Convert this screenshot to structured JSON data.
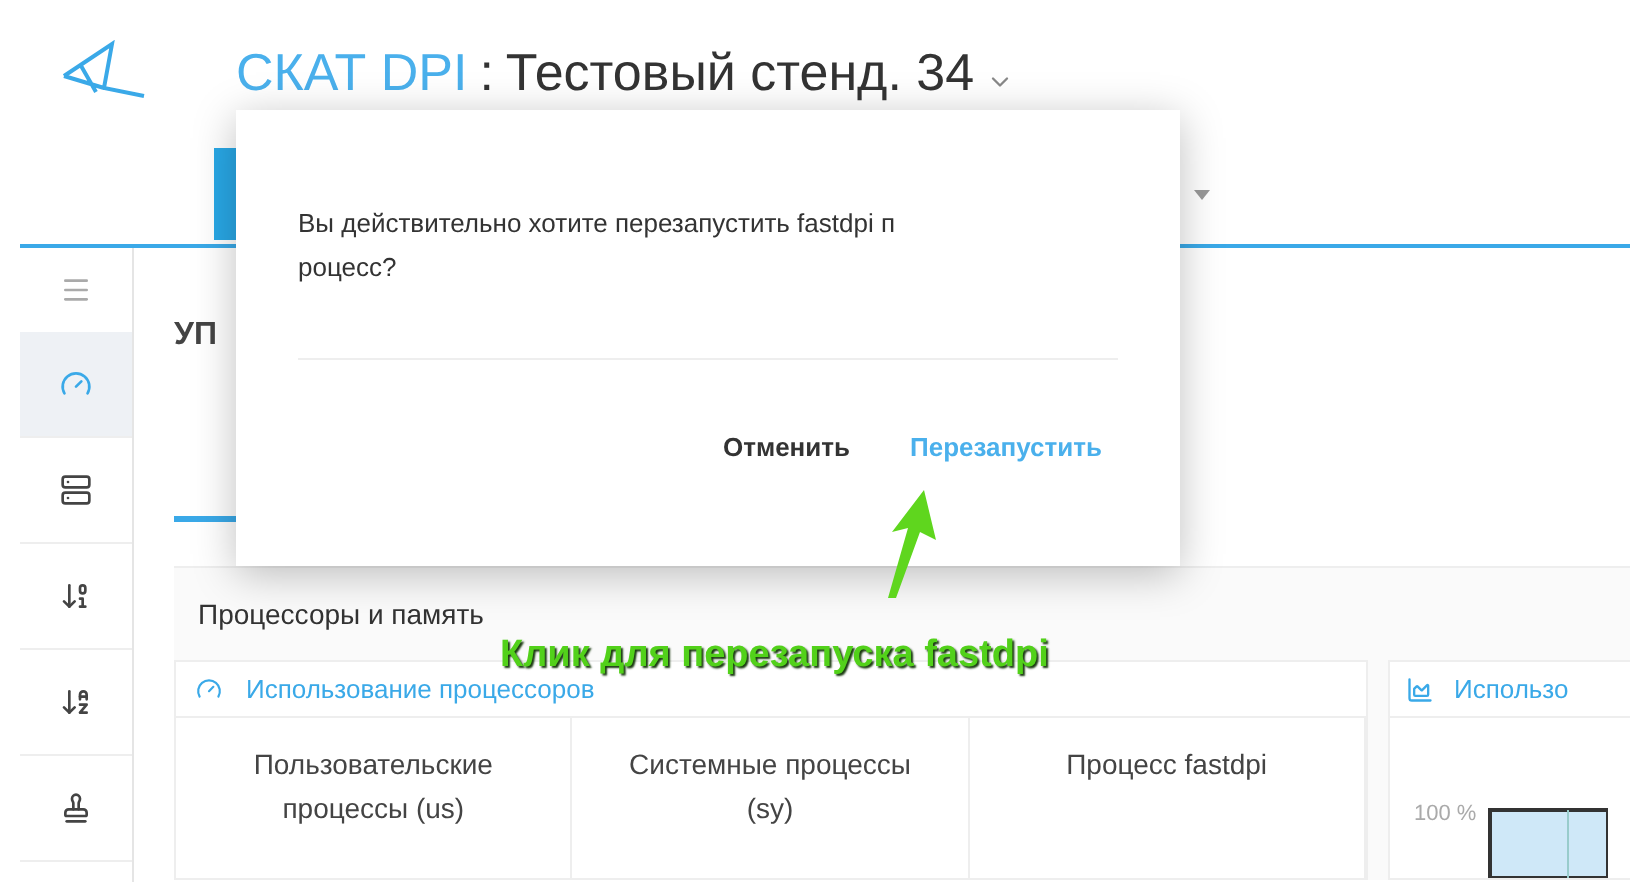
{
  "header": {
    "brand": "СКАТ DPI",
    "separator": ":",
    "stand": "Тестовый стенд. 34"
  },
  "sidebar": {
    "items": [
      {
        "kind": "gauge",
        "selected": true
      },
      {
        "kind": "server",
        "selected": false
      },
      {
        "kind": "sort-numeric",
        "selected": false
      },
      {
        "kind": "sort-alpha",
        "selected": false
      },
      {
        "kind": "sign",
        "selected": false
      }
    ]
  },
  "page": {
    "heading": "УП"
  },
  "section": {
    "title": "Процессоры и память"
  },
  "cpu_card": {
    "title": "Использование процессоров",
    "columns": [
      "Пользовательские процессы (us)",
      "Системные процессы (sy)",
      "Процесс fastdpi"
    ]
  },
  "chart_card": {
    "title": "Использо",
    "tick": "100 %"
  },
  "dialog": {
    "message_lines": [
      "Вы действительно хотите перезапустить fastdpi п",
      "роцесс?"
    ],
    "buttons": [
      {
        "label": "Отменить",
        "kind": "cancel"
      },
      {
        "label": "Перезапустить",
        "kind": "confirm"
      }
    ]
  },
  "annotation": {
    "text": "Клик для перезапуска fastdpi"
  }
}
